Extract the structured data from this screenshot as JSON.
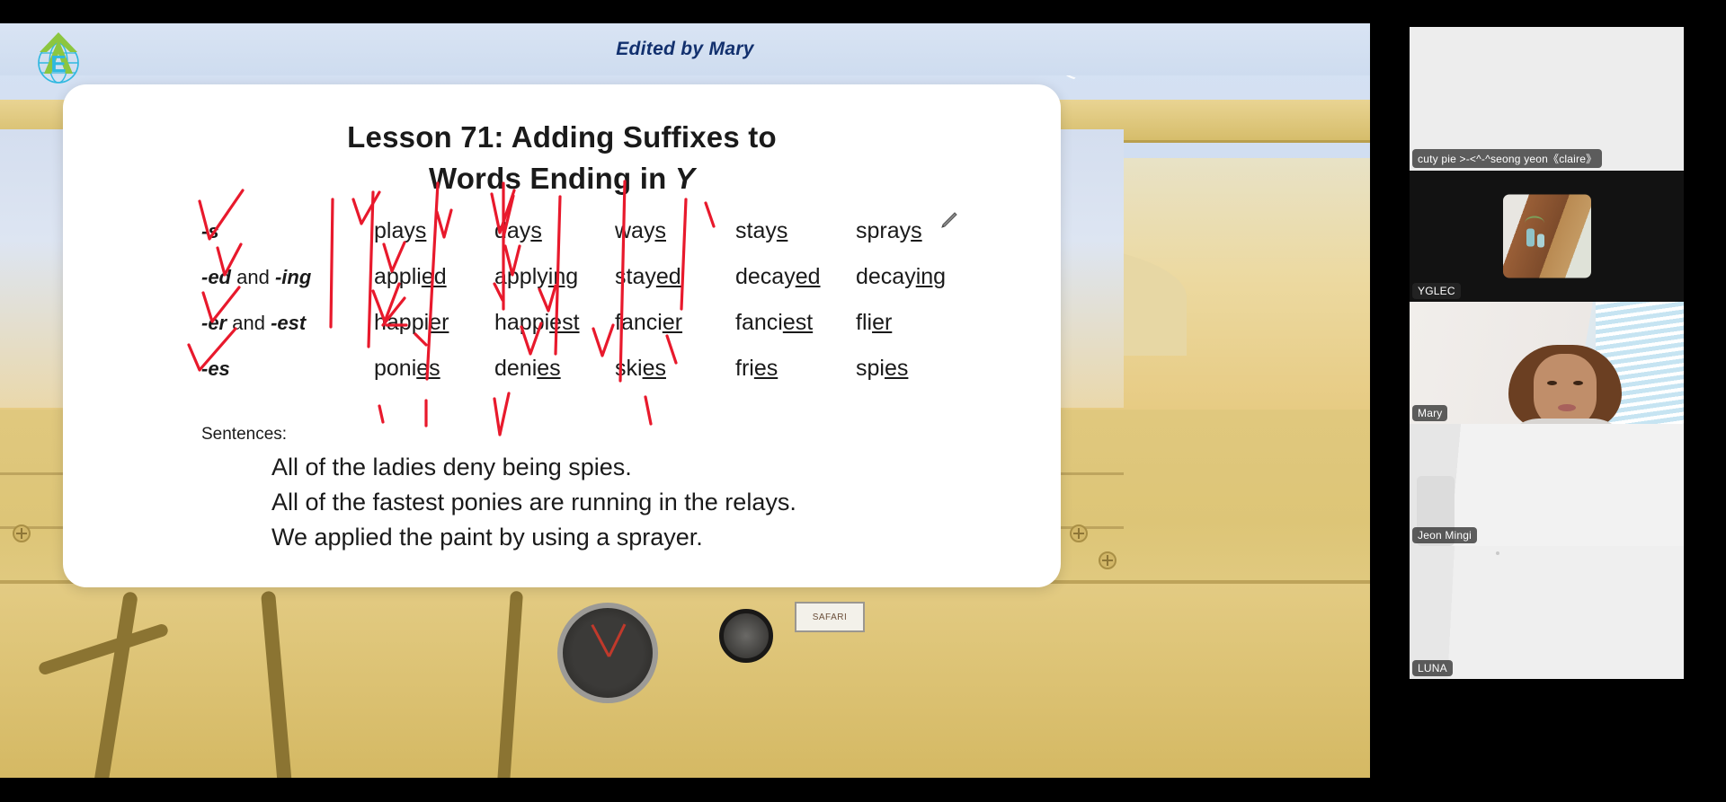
{
  "header": {
    "title": "Edited by Mary",
    "logo_icon": "eagle-globe-logo-icon"
  },
  "slide": {
    "title_line1": "Lesson 71: Adding Suffixes to",
    "title_line2_prefix": "Words Ending in ",
    "title_line2_italic": "Y",
    "rows": [
      {
        "suffix_plain": "-s",
        "suffix_html": "-s",
        "words": [
          {
            "stem": "play",
            "suffix": "s"
          },
          {
            "stem": "day",
            "suffix": "s"
          },
          {
            "stem": "way",
            "suffix": "s"
          },
          {
            "stem": "stay",
            "suffix": "s"
          },
          {
            "stem": "spray",
            "suffix": "s"
          }
        ]
      },
      {
        "suffix_plain": "-ed and -ing",
        "words": [
          {
            "stem": "appli",
            "suffix": "ed"
          },
          {
            "stem": "apply",
            "suffix": "ing"
          },
          {
            "stem": "stay",
            "suffix": "ed"
          },
          {
            "stem": "decay",
            "suffix": "ed"
          },
          {
            "stem": "decay",
            "suffix": "ing"
          }
        ]
      },
      {
        "suffix_plain": "-er and -est",
        "words": [
          {
            "stem": "happi",
            "suffix": "er"
          },
          {
            "stem": "happi",
            "suffix": "est"
          },
          {
            "stem": "fanci",
            "suffix": "er"
          },
          {
            "stem": "fanci",
            "suffix": "est"
          },
          {
            "stem": "fli",
            "suffix": "er"
          }
        ]
      },
      {
        "suffix_plain": "-es",
        "words": [
          {
            "stem": "poni",
            "suffix": "es"
          },
          {
            "stem": "deni",
            "suffix": "es"
          },
          {
            "stem": "ski",
            "suffix": "es"
          },
          {
            "stem": "fri",
            "suffix": "es"
          },
          {
            "stem": "spi",
            "suffix": "es"
          }
        ]
      }
    ],
    "sentences_label": "Sentences:",
    "sentences": [
      "All of the ladies deny being spies.",
      "All of the fastest ponies are running in the relays.",
      "We applied the paint by using a sprayer."
    ],
    "annotation_color": "#e8192c",
    "cursor_icon": "pencil-cursor-icon"
  },
  "sidebar": {
    "participants": [
      {
        "name": "cuty pie >-<^-^seong yeon《claire》",
        "active": false,
        "video": "blank"
      },
      {
        "name": "YGLEC",
        "active": false,
        "video": "thumbnail"
      },
      {
        "name": "Mary",
        "active": true,
        "video": "person"
      },
      {
        "name": "Jeon Mingi",
        "active": false,
        "video": "room"
      },
      {
        "name": "LUNA",
        "active": false,
        "video": "room"
      }
    ],
    "active_speaker_color": "#4ee68a"
  }
}
